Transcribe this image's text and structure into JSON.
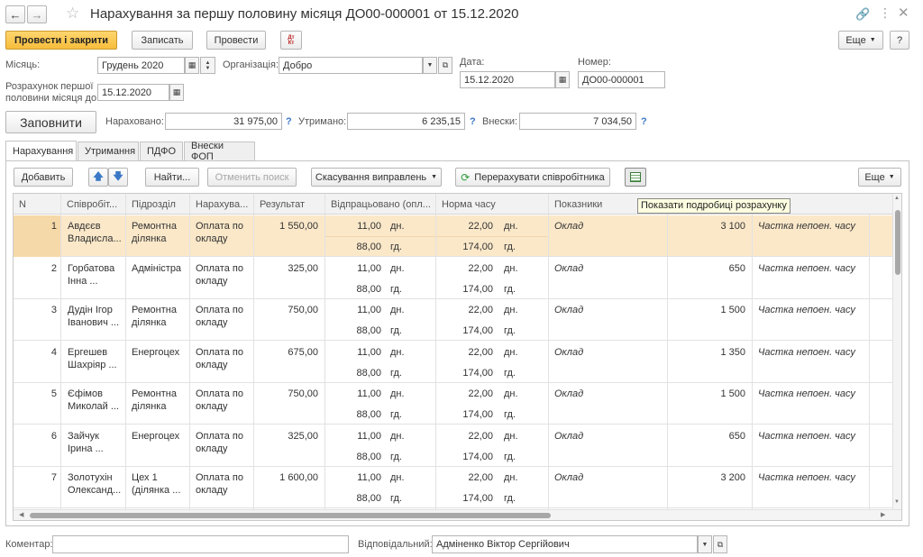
{
  "window": {
    "title": "Нарахування за першу половину місяця ДО00-000001 от 15.12.2020"
  },
  "toolbar": {
    "post_close": "Провести і закрити",
    "save": "Записать",
    "post": "Провести",
    "dt_kt": "Дт Кт",
    "more": "Еще",
    "help": "?"
  },
  "header": {
    "month_label": "Місяць:",
    "month_value": "Грудень 2020",
    "org_label": "Організація:",
    "org_value": "Добро",
    "date_label": "Дата:",
    "date_value": "15.12.2020",
    "number_label": "Номер:",
    "number_value": "ДО00-000001",
    "calc_label_1": "Розрахунок першої",
    "calc_label_2": "половини місяця до:",
    "calc_value": "15.12.2020"
  },
  "summary": {
    "fill_button": "Заповнити",
    "accrued_label": "Нараховано:",
    "accrued_value": "31 975,00",
    "withheld_label": "Утримано:",
    "withheld_value": "6 235,15",
    "contrib_label": "Внески:",
    "contrib_value": "7 034,50",
    "q": "?"
  },
  "tabs": [
    "Нарахування",
    "Утримання",
    "ПДФО",
    "Внески ФОП"
  ],
  "table_toolbar": {
    "add": "Добавить",
    "find": "Найти...",
    "cancel_search": "Отменить поиск",
    "cancel_corrections": "Скасування виправлень",
    "recalc": "Перерахувати співробітника",
    "more": "Еще",
    "tooltip": "Показати подробиці розрахунку"
  },
  "table": {
    "columns": [
      "N",
      "Співробіт...",
      "Підрозділ",
      "Нарахува...",
      "Результат",
      "Відпрацьовано (опл...",
      "Норма часу",
      "Показники"
    ],
    "rows": [
      {
        "n": "1",
        "emp1": "Авдєєв",
        "emp2": "Владисла...",
        "dep1": "Ремонтна",
        "dep2": "ділянка",
        "acc1": "Оплата по",
        "acc2": "окладу",
        "result": "1 550,00",
        "days": "11,00",
        "days_u": "дн.",
        "hours": "88,00",
        "hours_u": "гд.",
        "norm_days": "22,00",
        "norm_days_u": "дн.",
        "norm_hours": "174,00",
        "norm_hours_u": "гд.",
        "ind": "Оклад",
        "ind_val": "3 100",
        "ind2": "Частка непоен. часу"
      },
      {
        "n": "2",
        "emp1": "Горбатова",
        "emp2": "Інна ...",
        "dep1": "Адміністра",
        "dep2": "",
        "acc1": "Оплата по",
        "acc2": "окладу",
        "result": "325,00",
        "days": "11,00",
        "days_u": "дн.",
        "hours": "88,00",
        "hours_u": "гд.",
        "norm_days": "22,00",
        "norm_days_u": "дн.",
        "norm_hours": "174,00",
        "norm_hours_u": "гд.",
        "ind": "Оклад",
        "ind_val": "650",
        "ind2": "Частка непоен. часу"
      },
      {
        "n": "3",
        "emp1": "Дудін Ігор",
        "emp2": "Іванович ...",
        "dep1": "Ремонтна",
        "dep2": "ділянка",
        "acc1": "Оплата по",
        "acc2": "окладу",
        "result": "750,00",
        "days": "11,00",
        "days_u": "дн.",
        "hours": "88,00",
        "hours_u": "гд.",
        "norm_days": "22,00",
        "norm_days_u": "дн.",
        "norm_hours": "174,00",
        "norm_hours_u": "гд.",
        "ind": "Оклад",
        "ind_val": "1 500",
        "ind2": "Частка непоен. часу"
      },
      {
        "n": "4",
        "emp1": "Ергешев",
        "emp2": "Шахріяр ...",
        "dep1": "Енергоцех",
        "dep2": "",
        "acc1": "Оплата по",
        "acc2": "окладу",
        "result": "675,00",
        "days": "11,00",
        "days_u": "дн.",
        "hours": "88,00",
        "hours_u": "гд.",
        "norm_days": "22,00",
        "norm_days_u": "дн.",
        "norm_hours": "174,00",
        "norm_hours_u": "гд.",
        "ind": "Оклад",
        "ind_val": "1 350",
        "ind2": "Частка непоен. часу"
      },
      {
        "n": "5",
        "emp1": "Єфімов",
        "emp2": "Миколай ...",
        "dep1": "Ремонтна",
        "dep2": "ділянка",
        "acc1": "Оплата по",
        "acc2": "окладу",
        "result": "750,00",
        "days": "11,00",
        "days_u": "дн.",
        "hours": "88,00",
        "hours_u": "гд.",
        "norm_days": "22,00",
        "norm_days_u": "дн.",
        "norm_hours": "174,00",
        "norm_hours_u": "гд.",
        "ind": "Оклад",
        "ind_val": "1 500",
        "ind2": "Частка непоен. часу"
      },
      {
        "n": "6",
        "emp1": "Зайчук",
        "emp2": "Ірина ...",
        "dep1": "Енергоцех",
        "dep2": "",
        "acc1": "Оплата по",
        "acc2": "окладу",
        "result": "325,00",
        "days": "11,00",
        "days_u": "дн.",
        "hours": "88,00",
        "hours_u": "гд.",
        "norm_days": "22,00",
        "norm_days_u": "дн.",
        "norm_hours": "174,00",
        "norm_hours_u": "гд.",
        "ind": "Оклад",
        "ind_val": "650",
        "ind2": "Частка непоен. часу"
      },
      {
        "n": "7",
        "emp1": "Золотухін",
        "emp2": "Олександ...",
        "dep1": "Цех 1",
        "dep2": "(ділянка ...",
        "acc1": "Оплата по",
        "acc2": "окладу",
        "result": "1 600,00",
        "days": "11,00",
        "days_u": "дн.",
        "hours": "88,00",
        "hours_u": "гд.",
        "norm_days": "22,00",
        "norm_days_u": "дн.",
        "norm_hours": "174,00",
        "norm_hours_u": "гд.",
        "ind": "Оклад",
        "ind_val": "3 200",
        "ind2": "Частка непоен. часу"
      }
    ]
  },
  "footer": {
    "comment_label": "Коментар:",
    "comment_value": "",
    "responsible_label": "Відповідальний:",
    "responsible_value": "Адміненко Віктор Сергійович"
  },
  "colors": {
    "accent": "#f7bd3c",
    "selected_row": "#fbe8c9",
    "tooltip_bg": "#ffffe1",
    "link_blue": "#3b79c6",
    "recalc_green": "#2e9b3a"
  },
  "icons": [
    "back-arrow-icon",
    "forward-arrow-icon",
    "star-icon",
    "link-icon",
    "more-dots-icon",
    "close-icon",
    "calendar-icon",
    "dropdown-icon",
    "open-icon",
    "up-arrow-icon",
    "down-arrow-icon",
    "refresh-icon",
    "details-icon"
  ]
}
